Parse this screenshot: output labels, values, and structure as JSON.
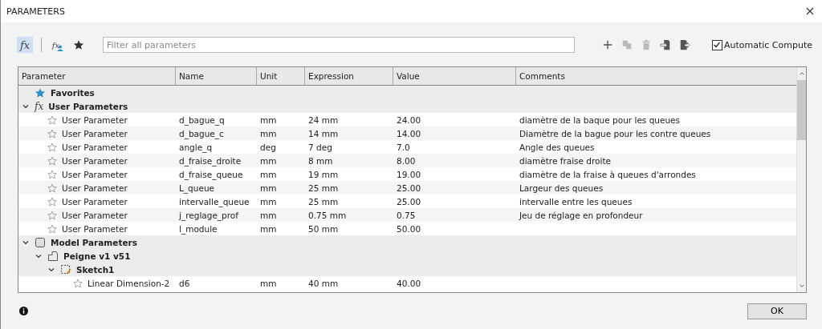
{
  "window": {
    "title": "PARAMETERS"
  },
  "toolbar": {
    "views": [
      {
        "kind": "fx",
        "glyph": "fx",
        "selected": true
      },
      {
        "kind": "fx-user",
        "glyph": "fx",
        "selected": false
      },
      {
        "kind": "star",
        "selected": false
      }
    ],
    "search": {
      "placeholder": "Filter all parameters"
    },
    "actions": [
      {
        "kind": "add",
        "disabled": false
      },
      {
        "kind": "copy",
        "disabled": true
      },
      {
        "kind": "delete",
        "disabled": true
      },
      {
        "kind": "import",
        "disabled": false
      },
      {
        "kind": "export",
        "disabled": false
      }
    ],
    "auto_compute": {
      "label": "Automatic Compute",
      "checked": true
    }
  },
  "table": {
    "columns": [
      "Parameter",
      "Name",
      "Unit",
      "Expression",
      "Value",
      "Comments"
    ],
    "tree": [
      {
        "kind": "favorites",
        "label": "Favorites"
      },
      {
        "kind": "user-group",
        "label": "User Parameters",
        "glyph": "fx",
        "expanded": true,
        "children": [
          {
            "kind": "parameter",
            "favorite": false,
            "cells": [
              "User Parameter",
              "d_bague_q",
              "mm",
              "24 mm",
              "24.00",
              "diamètre de la baque pour les queues"
            ]
          },
          {
            "kind": "parameter",
            "favorite": false,
            "cells": [
              "User Parameter",
              "d_bague_c",
              "mm",
              "14 mm",
              "14.00",
              "Diamètre de la bague pour les contre queues"
            ]
          },
          {
            "kind": "parameter",
            "favorite": false,
            "cells": [
              "User Parameter",
              "angle_q",
              "deg",
              "7 deg",
              "7.0",
              "Angle des queues"
            ]
          },
          {
            "kind": "parameter",
            "favorite": false,
            "cells": [
              "User Parameter",
              "d_fraise_droite",
              "mm",
              "8 mm",
              "8.00",
              "diamètre fraise droite"
            ]
          },
          {
            "kind": "parameter",
            "favorite": false,
            "cells": [
              "User Parameter",
              "d_fraise_queue",
              "mm",
              "19 mm",
              "19.00",
              "diamètre de la fraise à queues d'arrondes"
            ]
          },
          {
            "kind": "parameter",
            "favorite": false,
            "cells": [
              "User Parameter",
              "L_queue",
              "mm",
              "25 mm",
              "25.00",
              "Largeur des queues"
            ]
          },
          {
            "kind": "parameter",
            "favorite": false,
            "cells": [
              "User Parameter",
              "intervalle_queue",
              "mm",
              "25 mm",
              "25.00",
              "intervalle entre les queues"
            ]
          },
          {
            "kind": "parameter",
            "favorite": false,
            "cells": [
              "User Parameter",
              "j_reglage_prof",
              "mm",
              "0.75 mm",
              "0.75",
              "Jeu de réglage en profondeur"
            ]
          },
          {
            "kind": "parameter",
            "favorite": false,
            "cells": [
              "User Parameter",
              "l_module",
              "mm",
              "50 mm",
              "50.00"
            ]
          }
        ]
      },
      {
        "kind": "model-group",
        "label": "Model Parameters",
        "expanded": true,
        "children": [
          {
            "kind": "component",
            "label": "Peigne v1 v51",
            "expanded": true,
            "children": [
              {
                "kind": "sketch",
                "label": "Sketch1",
                "expanded": true,
                "children": [
                  {
                    "kind": "parameter",
                    "favorite": false,
                    "cells": [
                      "Linear Dimension-2",
                      "d6",
                      "mm",
                      "40 mm",
                      "40.00"
                    ]
                  }
                ]
              }
            ]
          }
        ]
      }
    ]
  },
  "footer": {
    "ok": "OK"
  }
}
